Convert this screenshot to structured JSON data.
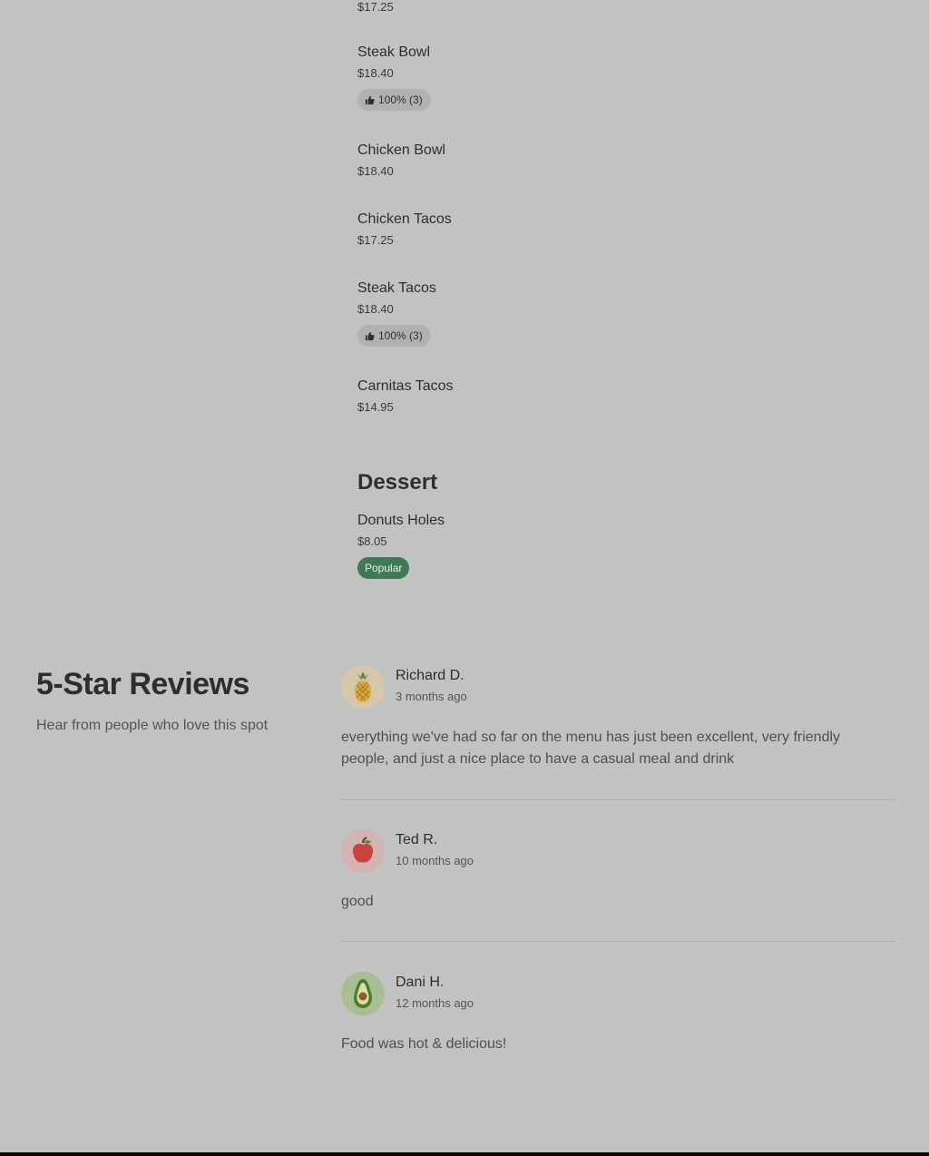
{
  "menu": {
    "top_price": "$17.25",
    "items": [
      {
        "name": "Steak Bowl",
        "price": "$18.40",
        "rating": "100% (3)"
      },
      {
        "name": "Chicken Bowl",
        "price": "$18.40"
      },
      {
        "name": "Chicken Tacos",
        "price": "$17.25"
      },
      {
        "name": "Steak Tacos",
        "price": "$18.40",
        "rating": "100% (3)"
      },
      {
        "name": "Carnitas Tacos",
        "price": "$14.95"
      }
    ],
    "dessert": {
      "title": "Dessert",
      "items": [
        {
          "name": "Donuts Holes",
          "price": "$8.05",
          "badge": "Popular"
        }
      ]
    }
  },
  "reviews": {
    "heading": "5-Star Reviews",
    "subheading": "Hear from people who love this spot",
    "list": [
      {
        "name": "Richard D.",
        "time": "3 months ago",
        "text": "everything we've had so far on the menu has just been excellent, very friendly people, and just a nice place to have a casual meal and drink",
        "avatar_icon": "pineapple-icon"
      },
      {
        "name": "Ted R.",
        "time": "10 months ago",
        "text": "good",
        "avatar_icon": "apple-icon"
      },
      {
        "name": "Dani H.",
        "time": "12 months ago",
        "text": "Food was hot & delicious!",
        "avatar_icon": "avocado-icon"
      }
    ]
  },
  "colors": {
    "background": "#c2c2c2",
    "popular_badge": "#3f7a54",
    "rating_pill": "#b1b1b1"
  }
}
